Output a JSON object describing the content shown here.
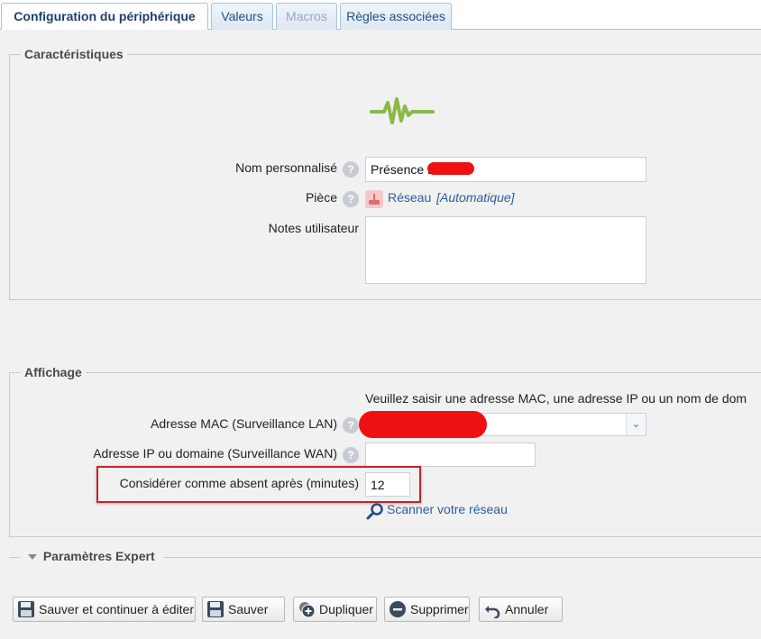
{
  "tabs": [
    {
      "label": "Configuration du périphérique"
    },
    {
      "label": "Valeurs"
    },
    {
      "label": "Macros"
    },
    {
      "label": "Règles associées"
    }
  ],
  "caracteristiques": {
    "legend": "Caractéristiques",
    "nom_label": "Nom personnalisé",
    "nom_value": "Présence L",
    "piece_label": "Pièce",
    "piece_value": "Réseau",
    "piece_mode": "[Automatique]",
    "notes_label": "Notes utilisateur",
    "notes_value": ""
  },
  "affichage": {
    "legend": "Affichage",
    "hint": "Veuillez saisir une adresse MAC, une adresse IP ou un nom de dom",
    "mac_label": "Adresse MAC (Surveillance LAN)",
    "mac_value": "",
    "ip_label": "Adresse IP ou domaine (Surveillance WAN)",
    "ip_value": "",
    "absent_label": "Considérer comme absent après (minutes)",
    "absent_value": "12",
    "scan_label": "Scanner votre réseau"
  },
  "expert": {
    "label": "Paramètres Expert"
  },
  "buttons": {
    "save_continue": "Sauver et continuer à éditer",
    "save": "Sauver",
    "duplicate": "Dupliquer",
    "delete": "Supprimer",
    "cancel": "Annuler"
  },
  "colors": {
    "device_icon": "#8cb84a",
    "highlight": "#c8222a",
    "link": "#2a5d9f"
  },
  "icons": {
    "device": "pulse-icon",
    "help": "help-icon",
    "room": "room-icon",
    "scan": "magnifier-icon",
    "expert": "triangle-down-icon"
  }
}
